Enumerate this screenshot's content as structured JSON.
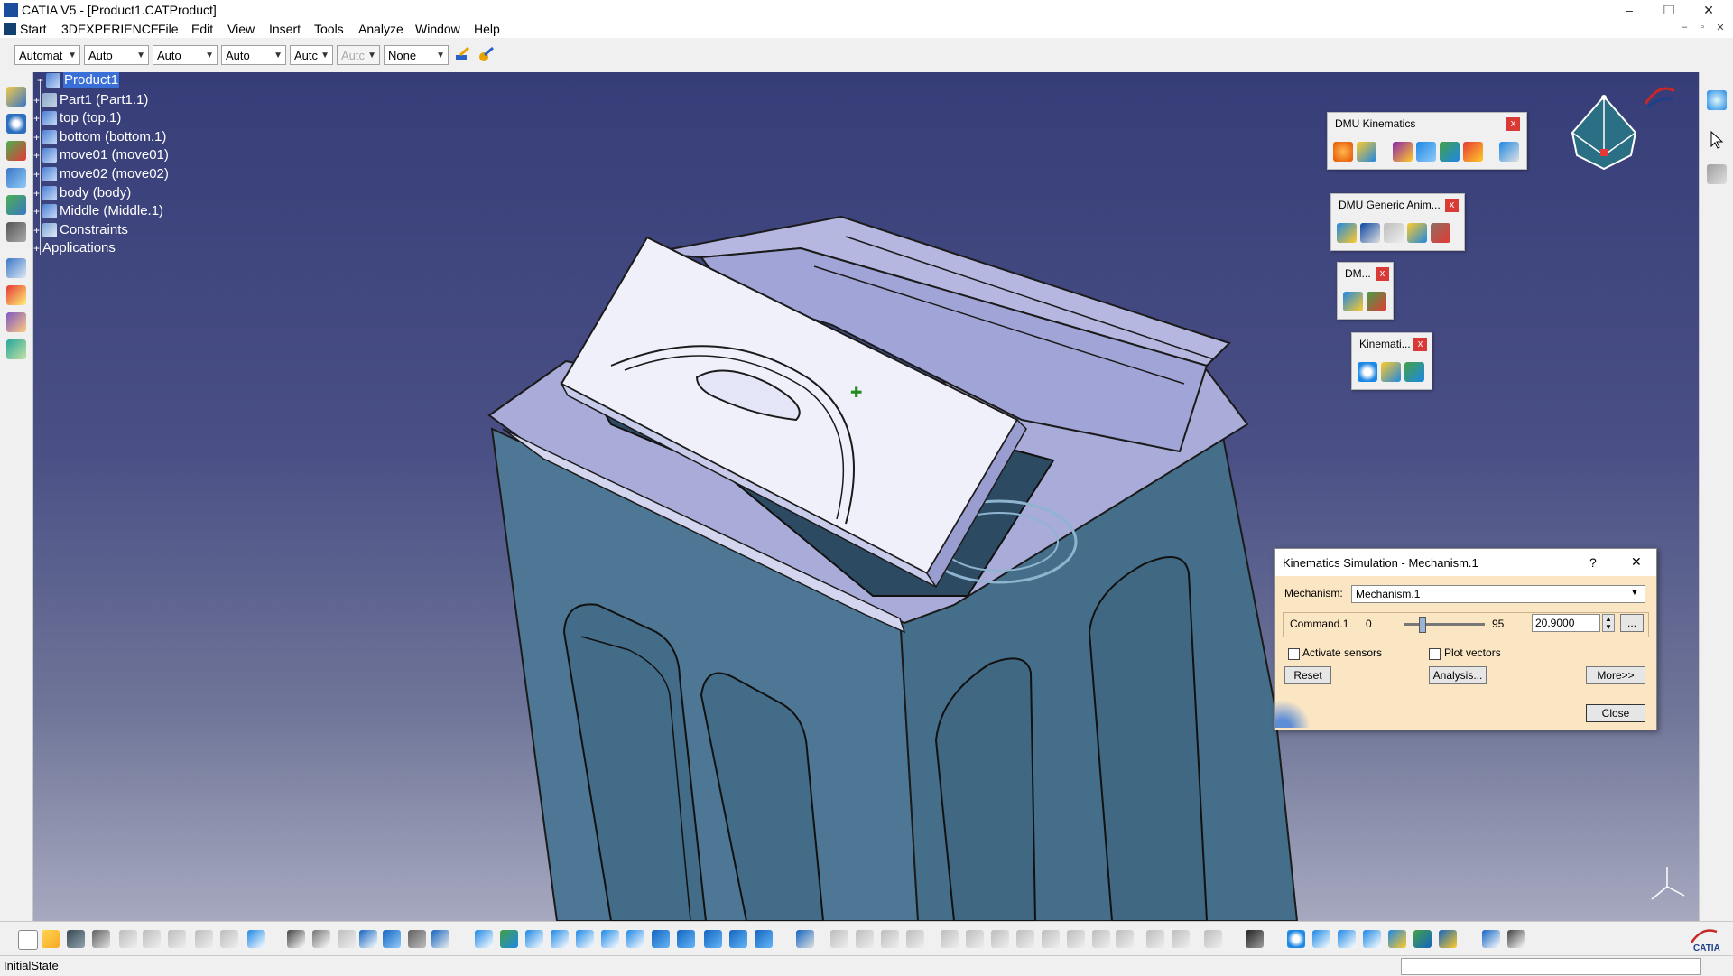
{
  "window": {
    "title": "CATIA V5 - [Product1.CATProduct]",
    "controls": [
      "–",
      "❐",
      "✕"
    ],
    "mdi_controls": [
      "–",
      "▫",
      "✕"
    ]
  },
  "menu": {
    "items": [
      "Start",
      "3DEXPERIENCE",
      "File",
      "Edit",
      "View",
      "Insert",
      "Tools",
      "Analyze",
      "Window",
      "Help"
    ]
  },
  "toolbar_combos": [
    "Automat",
    "Auto",
    "Auto",
    "Auto",
    "Autc",
    "Autc",
    "None"
  ],
  "tree": {
    "root": "Product1",
    "children": [
      "Part1 (Part1.1)",
      "top (top.1)",
      "bottom (bottom.1)",
      "move01 (move01)",
      "move02 (move02)",
      "body (body)",
      "Middle (Middle.1)",
      "Constraints"
    ],
    "applications": "Applications"
  },
  "floating_toolbars": [
    {
      "title": "DMU Kinematics",
      "close": "x"
    },
    {
      "title": "DMU Generic Anim...",
      "close": "x"
    },
    {
      "title": "DM...",
      "close": "x"
    },
    {
      "title": "Kinemati...",
      "close": "x"
    }
  ],
  "dialog": {
    "title": "Kinematics Simulation - Mechanism.1",
    "help": "?",
    "close_x": "✕",
    "mechanism_label": "Mechanism:",
    "mechanism_value": "Mechanism.1",
    "command_label": "Command.1",
    "slider_min": "0",
    "slider_max": "95",
    "slider_fraction": 0.22,
    "command_value": "20.9000",
    "ellipsis": "...",
    "activate_sensors": "Activate sensors",
    "plot_vectors": "Plot vectors",
    "reset": "Reset",
    "analysis": "Analysis...",
    "more": "More>>",
    "close": "Close"
  },
  "status": {
    "text": "InitialState"
  },
  "brand": {
    "logo": "CATIA"
  },
  "colors": {
    "viewport_top": "#363d78",
    "viewport_bottom": "#a6a9bf",
    "tree_selection": "#3a6fd8",
    "dialog_background": "#fbe6c4",
    "close_red": "#d93a36"
  }
}
